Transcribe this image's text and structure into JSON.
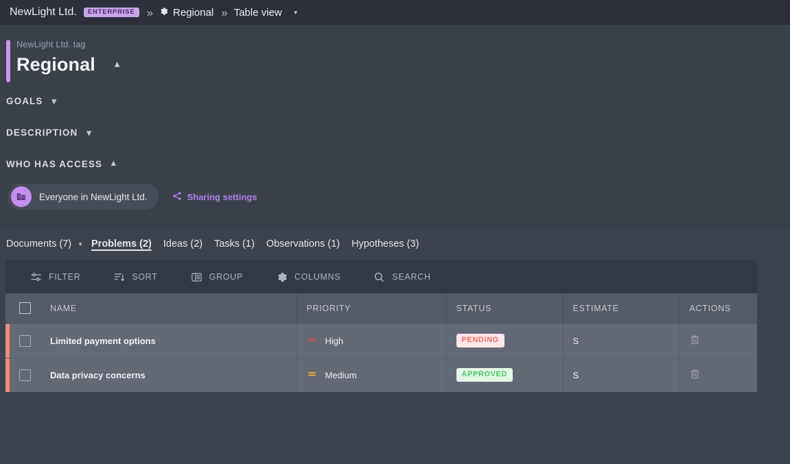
{
  "breadcrumb": {
    "org": "NewLight Ltd.",
    "plan_badge": "ENTERPRISE",
    "separator": "»",
    "tag_name": "Regional",
    "view_name": "Table view",
    "gear_icon": "gear-icon",
    "caret_icon": "chevron-down-icon"
  },
  "detail": {
    "tag_label": "NewLight Ltd. tag",
    "title": "Regional",
    "title_toggle_icon": "chevron-up-icon",
    "accent_color": "#cb92f2",
    "sections": [
      {
        "label": "GOALS",
        "expanded": false,
        "icon": "chevron-down-icon"
      },
      {
        "label": "DESCRIPTION",
        "expanded": false,
        "icon": "chevron-down-icon"
      },
      {
        "label": "WHO HAS ACCESS",
        "expanded": true,
        "icon": "chevron-up-icon"
      }
    ],
    "access": {
      "avatar_icon": "building-icon",
      "avatar_color": "#c68ef0",
      "chip_label": "Everyone in NewLight Ltd.",
      "share_icon": "share-icon",
      "share_label": "Sharing settings",
      "share_color": "#b07ee8"
    }
  },
  "tabs": [
    {
      "label": "Documents (7)",
      "active": false,
      "has_caret": true
    },
    {
      "label": "Problems (2)",
      "active": true,
      "has_caret": false
    },
    {
      "label": "Ideas (2)",
      "active": false,
      "has_caret": false
    },
    {
      "label": "Tasks (1)",
      "active": false,
      "has_caret": false
    },
    {
      "label": "Observations (1)",
      "active": false,
      "has_caret": false
    },
    {
      "label": "Hypotheses (3)",
      "active": false,
      "has_caret": false
    }
  ],
  "toolbar": [
    {
      "label": "FILTER",
      "icon": "filter-sliders-icon"
    },
    {
      "label": "SORT",
      "icon": "sort-icon"
    },
    {
      "label": "GROUP",
      "icon": "group-list-icon"
    },
    {
      "label": "COLUMNS",
      "icon": "gear-icon"
    },
    {
      "label": "SEARCH",
      "icon": "search-icon"
    }
  ],
  "table": {
    "select_all_icon": "checkbox-icon",
    "columns": [
      "NAME",
      "PRIORITY",
      "STATUS",
      "ESTIMATE",
      "ACTIONS"
    ],
    "row_accent_color": "#f08d78",
    "rows": [
      {
        "checkbox_icon": "checkbox-icon",
        "name": "Limited payment options",
        "priority": "High",
        "priority_icon": "chevron-up-icon",
        "priority_color": "#e0513c",
        "status": "PENDING",
        "status_style": "pending",
        "estimate": "S",
        "action_icon": "trash-icon"
      },
      {
        "checkbox_icon": "checkbox-icon",
        "name": "Data privacy concerns",
        "priority": "Medium",
        "priority_icon": "equals-icon",
        "priority_color": "#e8a33d",
        "status": "APPROVED",
        "status_style": "approved",
        "estimate": "S",
        "action_icon": "trash-icon"
      }
    ]
  }
}
